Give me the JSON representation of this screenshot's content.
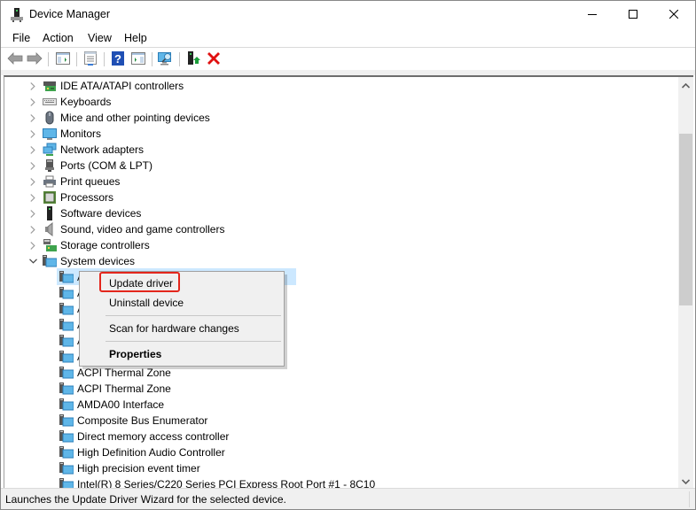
{
  "window": {
    "title": "Device Manager",
    "app_icon": "device-manager-icon",
    "controls": {
      "minimize": "minimize-icon",
      "maximize": "maximize-icon",
      "close": "close-icon"
    }
  },
  "menu": {
    "items": [
      "File",
      "Action",
      "View",
      "Help"
    ]
  },
  "toolbar": {
    "buttons": [
      {
        "name": "back-button",
        "icon": "arrow-left-icon"
      },
      {
        "name": "forward-button",
        "icon": "arrow-right-icon"
      },
      {
        "name": "show-hide-console-tree-button",
        "icon": "console-tree-icon"
      },
      {
        "name": "properties-button",
        "icon": "properties-icon"
      },
      {
        "name": "help-button",
        "icon": "help-icon"
      },
      {
        "name": "show-hide-action-pane-button",
        "icon": "action-pane-icon"
      },
      {
        "name": "scan-hardware-button",
        "icon": "scan-monitor-icon"
      },
      {
        "name": "update-driver-button",
        "icon": "update-driver-icon"
      },
      {
        "name": "uninstall-device-button",
        "icon": "red-x-icon"
      }
    ],
    "colors": {
      "help_blue": "#1f4fb4",
      "uninstall_red": "#e01010",
      "update_green": "#1a9e3a"
    }
  },
  "tree": {
    "categories": [
      {
        "label": "IDE ATA/ATAPI controllers",
        "icon": "ide-controller-icon",
        "expanded": false
      },
      {
        "label": "Keyboards",
        "icon": "keyboard-icon",
        "expanded": false
      },
      {
        "label": "Mice and other pointing devices",
        "icon": "mouse-icon",
        "expanded": false
      },
      {
        "label": "Monitors",
        "icon": "monitor-icon",
        "expanded": false
      },
      {
        "label": "Network adapters",
        "icon": "network-adapter-icon",
        "expanded": false
      },
      {
        "label": "Ports (COM & LPT)",
        "icon": "port-icon",
        "expanded": false
      },
      {
        "label": "Print queues",
        "icon": "printer-icon",
        "expanded": false
      },
      {
        "label": "Processors",
        "icon": "processor-icon",
        "expanded": false
      },
      {
        "label": "Software devices",
        "icon": "software-device-icon",
        "expanded": false
      },
      {
        "label": "Sound, video and game controllers",
        "icon": "speaker-icon",
        "expanded": false
      },
      {
        "label": "Storage controllers",
        "icon": "storage-controller-icon",
        "expanded": false
      },
      {
        "label": "System devices",
        "icon": "system-device-icon",
        "expanded": true
      }
    ],
    "system_devices": [
      {
        "label": "A",
        "selected": true
      },
      {
        "label": "A",
        "selected": false
      },
      {
        "label": "A",
        "selected": false
      },
      {
        "label": "A",
        "selected": false
      },
      {
        "label": "A",
        "selected": false
      },
      {
        "label": "A",
        "selected": false
      },
      {
        "label": "ACPI Thermal Zone",
        "selected": false
      },
      {
        "label": "ACPI Thermal Zone",
        "selected": false
      },
      {
        "label": "AMDA00 Interface",
        "selected": false
      },
      {
        "label": "Composite Bus Enumerator",
        "selected": false
      },
      {
        "label": "Direct memory access controller",
        "selected": false
      },
      {
        "label": "High Definition Audio Controller",
        "selected": false
      },
      {
        "label": "High precision event timer",
        "selected": false
      },
      {
        "label": "Intel(R) 8 Series/C220 Series PCI Express Root Port #1 - 8C10",
        "selected": false
      }
    ],
    "selection_color": "#cce8ff"
  },
  "context_menu": {
    "items": [
      {
        "label": "Update driver",
        "bold": false,
        "highlighted": true
      },
      {
        "label": "Uninstall device",
        "bold": false,
        "highlighted": false
      },
      {
        "label": "Scan for hardware changes",
        "bold": false,
        "highlighted": false
      },
      {
        "label": "Properties",
        "bold": true,
        "highlighted": false
      }
    ],
    "highlight_color": "#e3261c"
  },
  "statusbar": {
    "text": "Launches the Update Driver Wizard for the selected device."
  }
}
